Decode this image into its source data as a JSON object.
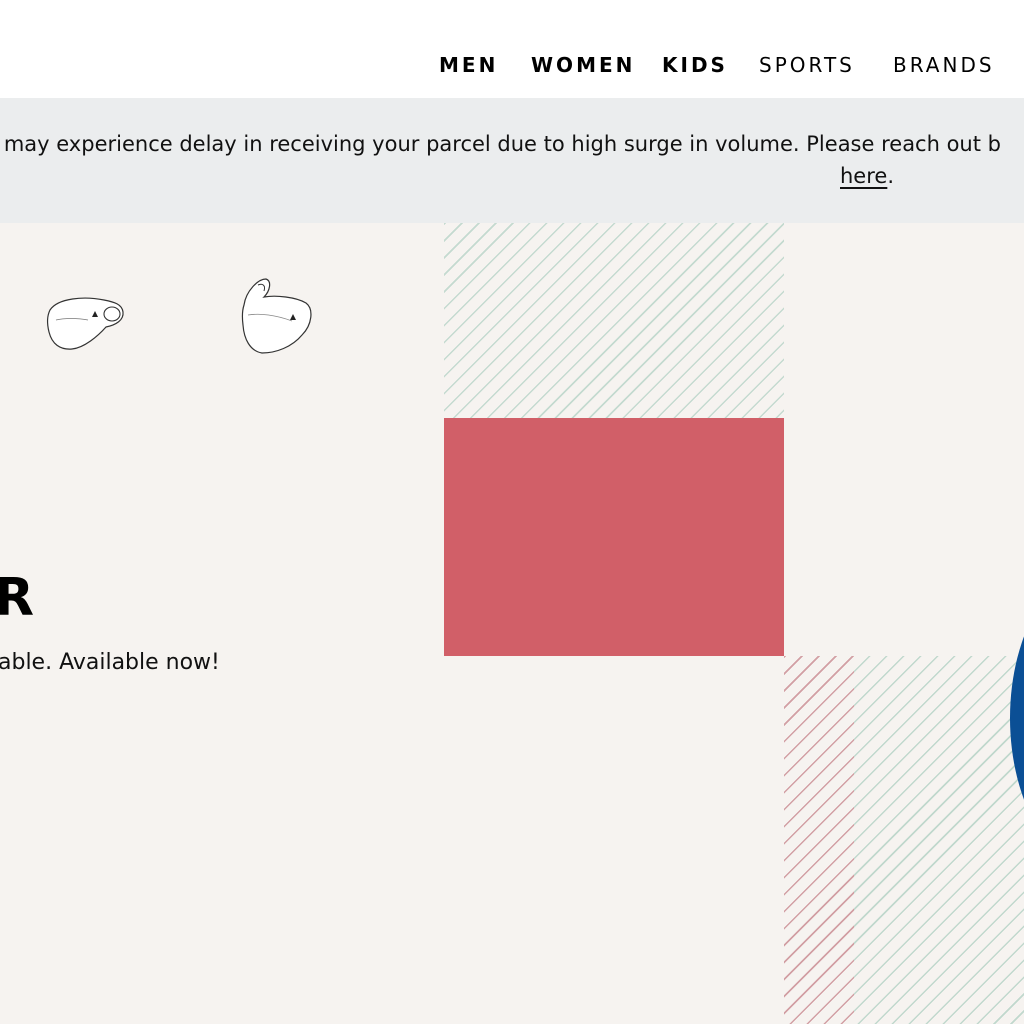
{
  "nav": {
    "items": [
      {
        "label": "MEN"
      },
      {
        "label": "WOMEN"
      },
      {
        "label": "KIDS"
      },
      {
        "label": "SPORTS"
      },
      {
        "label": "BRANDS"
      }
    ]
  },
  "notice": {
    "text": "ou may experience delay in receiving your parcel due to high surge in volume. Please reach out b",
    "link_label": "here",
    "trailing": "."
  },
  "hero": {
    "title_fragment": "R",
    "subtitle_fragment": "able. Available now!",
    "icons": [
      "face-mask-icon",
      "face-mask-side-icon"
    ]
  },
  "colors": {
    "notice_bg": "#ebedee",
    "hero_bg": "#f6f3f0",
    "accent_red": "#d15f68",
    "accent_blue": "#0b4f95",
    "hatch_green": "#aacdbe",
    "hatch_pink": "#d78c96"
  }
}
